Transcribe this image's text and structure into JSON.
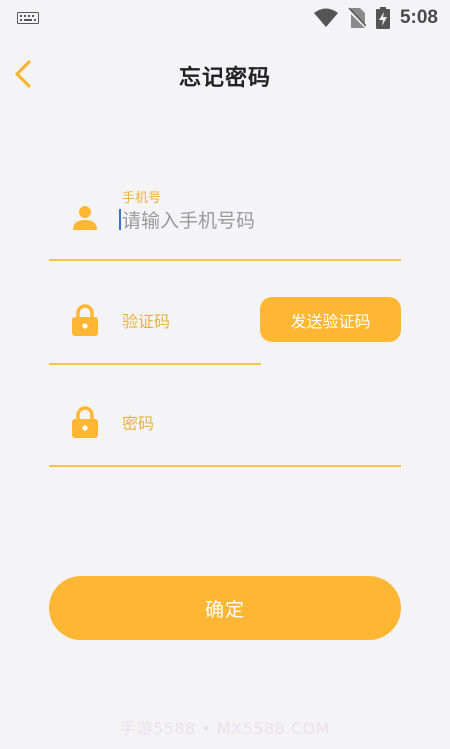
{
  "status_bar": {
    "time": "5:08",
    "icons": [
      "keyboard-icon",
      "wifi-icon",
      "no-sim-icon",
      "battery-charging-icon"
    ]
  },
  "header": {
    "title": "忘记密码",
    "back_icon": "chevron-left-icon"
  },
  "form": {
    "phone": {
      "label": "手机号",
      "placeholder": "请输入手机号码",
      "icon": "person-icon"
    },
    "code": {
      "label": "验证码",
      "icon": "lock-icon",
      "send_button": "发送验证码"
    },
    "password": {
      "label": "密码",
      "icon": "lock-icon"
    },
    "confirm_button": "确定"
  },
  "watermark": "手游5588 • MX5588.COM",
  "colors": {
    "accent": "#fdb734",
    "label": "#e9b23a",
    "underline": "#f6c54c",
    "background": "#f4f4f6"
  }
}
